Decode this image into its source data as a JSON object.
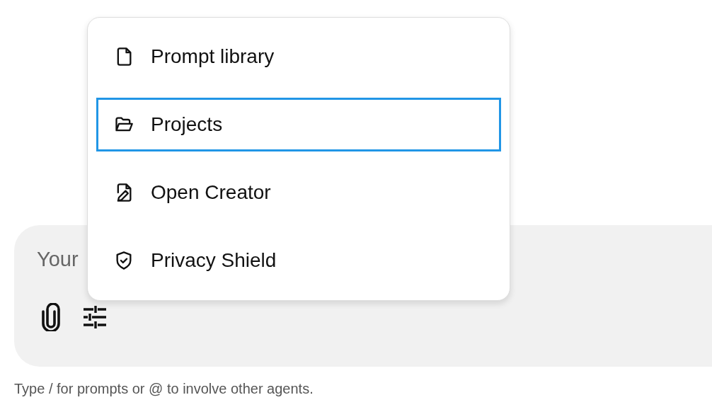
{
  "composer": {
    "placeholder": "Your"
  },
  "menu": {
    "items": [
      {
        "label": "Prompt library",
        "selected": false
      },
      {
        "label": "Projects",
        "selected": true
      },
      {
        "label": "Open Creator",
        "selected": false
      },
      {
        "label": "Privacy Shield",
        "selected": false
      }
    ]
  },
  "hint": "Type / for prompts or @ to involve other agents."
}
